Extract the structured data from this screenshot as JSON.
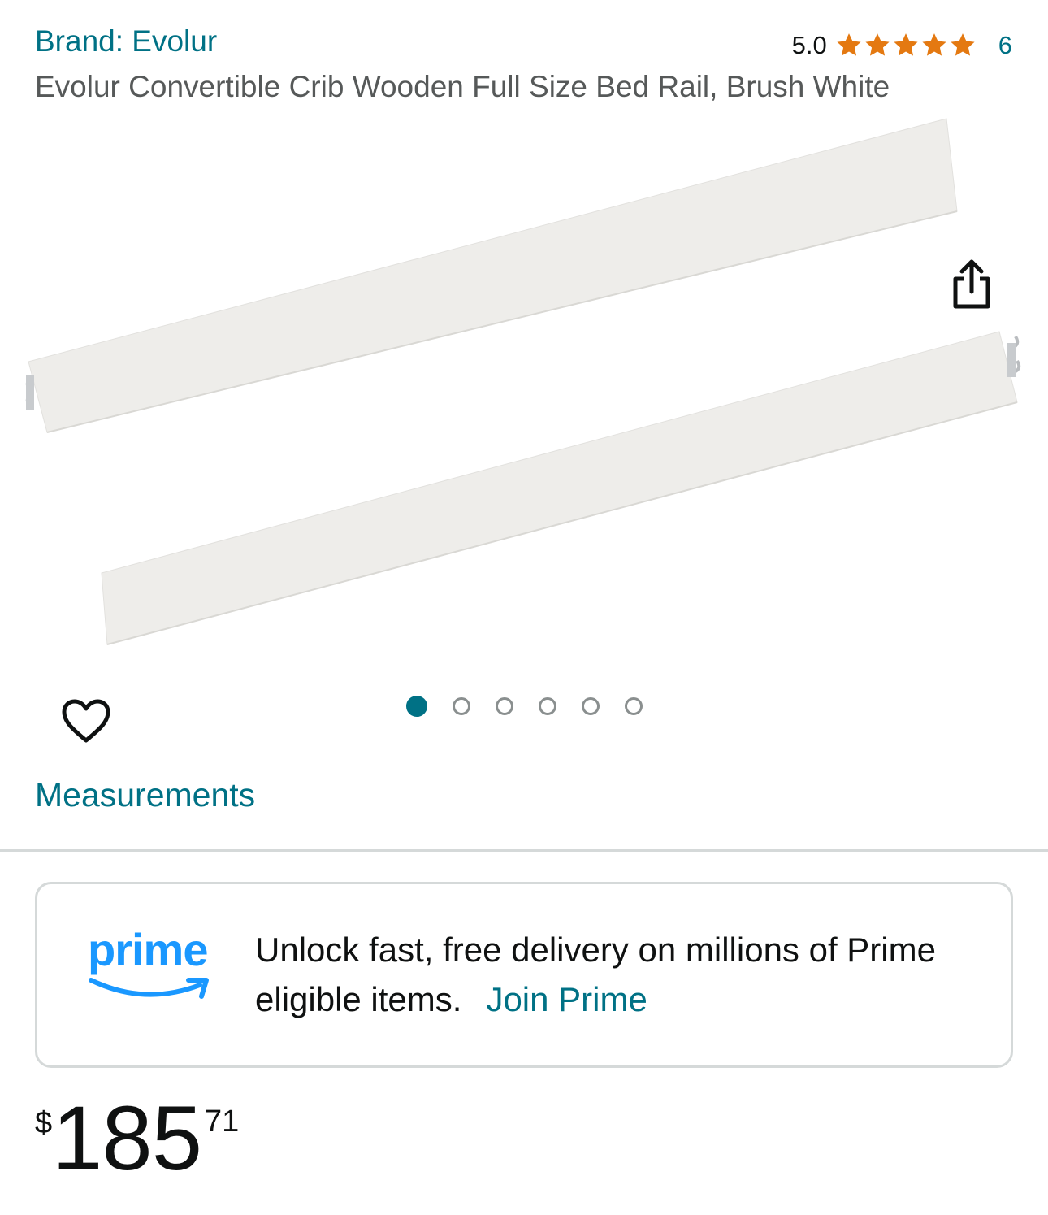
{
  "brand": "Brand: Evolur",
  "rating": {
    "value": "5.0",
    "stars": 5,
    "count": "6",
    "star_color": "#e47911"
  },
  "title": "Evolur Convertible Crib Wooden Full Size Bed Rail, Brush White",
  "gallery": {
    "image_count": 6,
    "active_index": 0,
    "share_icon": "share-icon",
    "favorite_icon": "heart-icon"
  },
  "measurements_label": "Measurements",
  "prime": {
    "logo_text": "prime",
    "message": "Unlock fast, free delivery on millions of Prime eligible items.",
    "join_label": "Join Prime",
    "logo_color": "#1a98ff"
  },
  "price": {
    "symbol": "$",
    "whole": "185",
    "fraction": "71"
  },
  "colors": {
    "link": "#007185",
    "text": "#0f1111",
    "secondary_text": "#565959"
  }
}
